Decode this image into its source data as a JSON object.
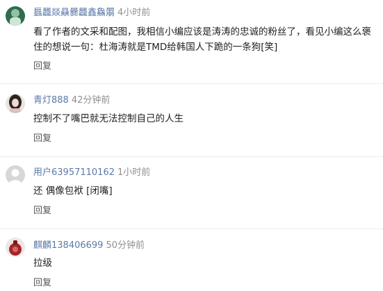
{
  "comments": [
    {
      "username": "螶龘燚贔爨龘鑫鱻朤",
      "time": "4小时前",
      "text_line1": "看了作者的文采和配图，我相信小编应该是涛涛的忠诚的粉丝了，看见小编这么褒",
      "text_line2": "住的想说一句：杜海涛就是TMD给韩国人下跪的一条狗[笑]",
      "reply": "回复"
    },
    {
      "username": "青灯888",
      "time": "42分钟前",
      "text_line1": "控制不了嘴巴就无法控制自己的人生",
      "reply": "回复"
    },
    {
      "username": "用户63957110162",
      "time": "1小时前",
      "text_line1": "还 偶像包袱 [闭嘴]",
      "reply": "回复"
    },
    {
      "username": "麒麟138406699",
      "time": "50分钟前",
      "text_line1": "拉级",
      "reply": "回复"
    }
  ]
}
